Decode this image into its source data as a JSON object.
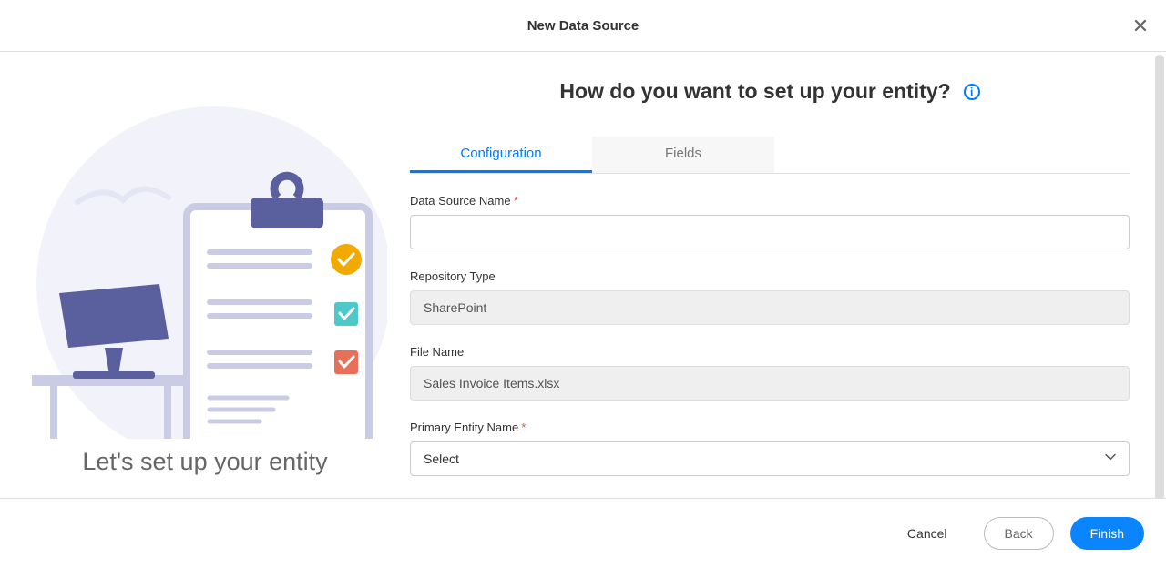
{
  "header": {
    "title": "New Data Source"
  },
  "left": {
    "caption": "Let's set up your entity"
  },
  "main": {
    "question": "How do you want to set up your entity?",
    "tabs": [
      {
        "label": "Configuration",
        "active": true
      },
      {
        "label": "Fields",
        "active": false
      }
    ],
    "fields": {
      "dataSourceName": {
        "label": "Data Source Name",
        "required": true,
        "value": ""
      },
      "repositoryType": {
        "label": "Repository Type",
        "required": false,
        "value": "SharePoint"
      },
      "fileName": {
        "label": "File Name",
        "required": false,
        "value": "Sales Invoice Items.xlsx"
      },
      "primaryEntityName": {
        "label": "Primary Entity Name",
        "required": true,
        "value": "Select"
      }
    }
  },
  "footer": {
    "cancel": "Cancel",
    "back": "Back",
    "finish": "Finish"
  }
}
